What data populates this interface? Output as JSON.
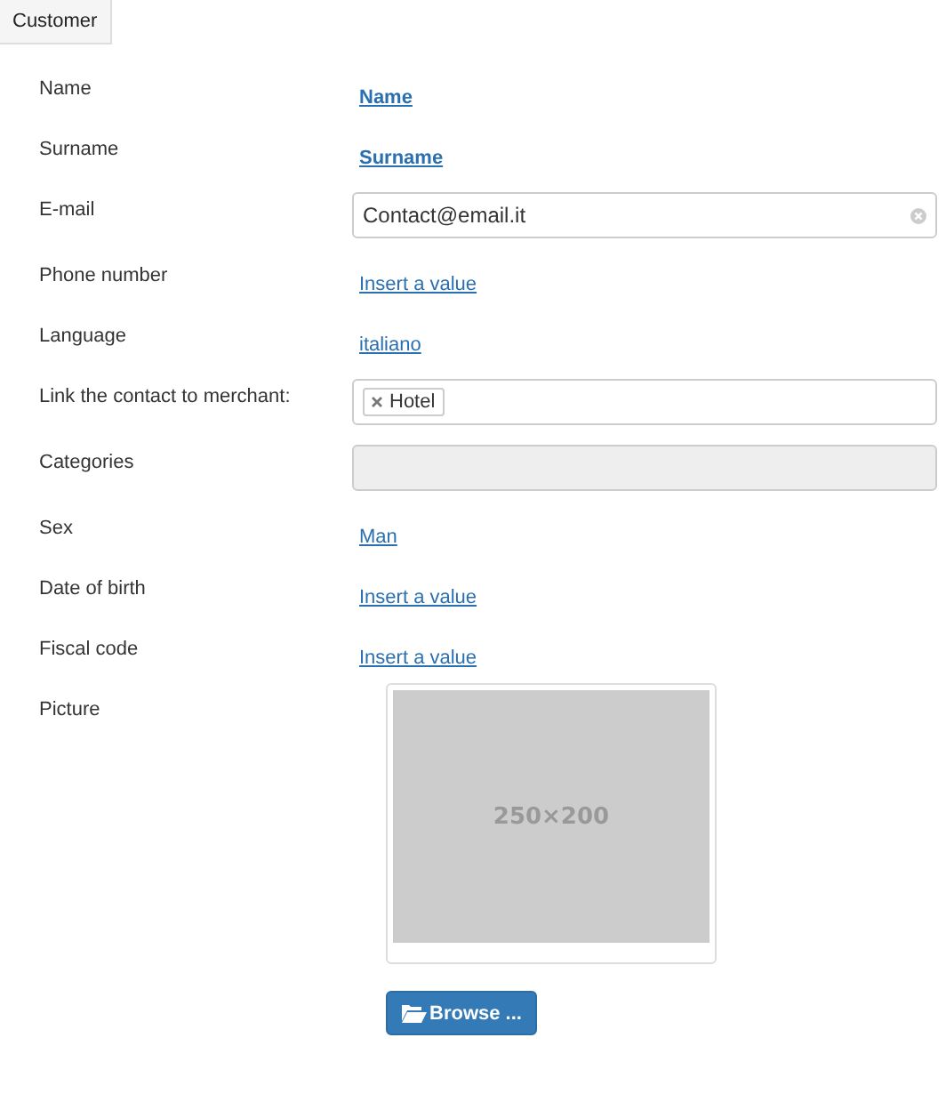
{
  "tab": {
    "label": "Customer",
    "selected": true
  },
  "fields": [
    {
      "label": "Name",
      "kind": "link",
      "value": "Name",
      "bold": true
    },
    {
      "label": "Surname",
      "kind": "link",
      "value": "Surname",
      "bold": true
    },
    {
      "label": "E-mail",
      "kind": "input",
      "value": "Contact@email.it"
    },
    {
      "label": "Phone number",
      "kind": "link",
      "value": "Insert a value",
      "bold": false
    },
    {
      "label": "Language",
      "kind": "link",
      "value": "italiano",
      "bold": false
    },
    {
      "label": "Link the contact to merchant:",
      "kind": "tags",
      "tags": [
        "Hotel"
      ]
    },
    {
      "label": "Categories",
      "kind": "input",
      "disabled": true
    },
    {
      "label": "Sex",
      "kind": "link",
      "value": "Man",
      "bold": false
    },
    {
      "label": "Date of birth",
      "kind": "link",
      "value": "Insert a value",
      "bold": false
    },
    {
      "label": "Fiscal code",
      "kind": "link",
      "value": "Insert a value",
      "bold": false
    },
    {
      "label": "Picture",
      "kind": "picture",
      "placeholder_text": "250×200",
      "button": "Browse ..."
    }
  ]
}
